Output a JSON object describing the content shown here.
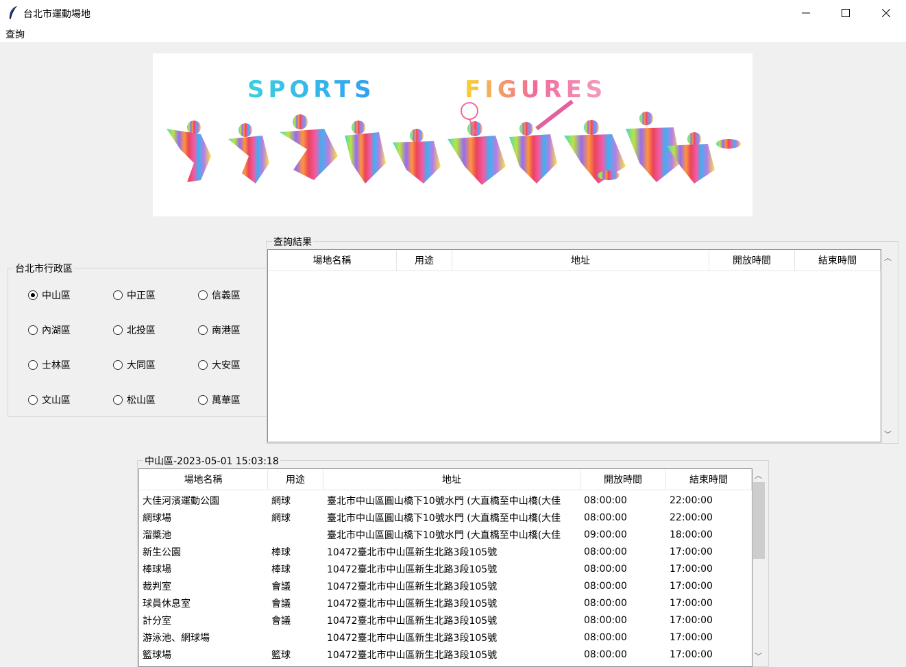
{
  "window": {
    "title": "台北市運動場地"
  },
  "menu": {
    "items": [
      "查詢"
    ]
  },
  "banner": {
    "text_left": "SPORTS",
    "text_right": "FIGURES"
  },
  "district_group": {
    "label": "台北市行政區",
    "selected": "中山區",
    "options": [
      "中山區",
      "中正區",
      "信義區",
      "內湖區",
      "北投區",
      "南港區",
      "士林區",
      "大同區",
      "大安區",
      "文山區",
      "松山區",
      "萬華區"
    ]
  },
  "query_results": {
    "label": "查詢結果",
    "columns": [
      "場地名稱",
      "用途",
      "地址",
      "開放時間",
      "結束時間"
    ],
    "rows": []
  },
  "district_table": {
    "label": "中山區-2023-05-01 15:03:18",
    "columns": [
      "場地名稱",
      "用途",
      "地址",
      "開放時間",
      "結束時間"
    ],
    "rows": [
      [
        "大佳河濱運動公園",
        "網球",
        "臺北市中山區圓山橋下10號水門 (大直橋至中山橋(大佳",
        "08:00:00",
        "22:00:00"
      ],
      [
        "網球場",
        "網球",
        "臺北市中山區圓山橋下10號水門 (大直橋至中山橋(大佳",
        "08:00:00",
        "22:00:00"
      ],
      [
        "溜槳池",
        "",
        "臺北市中山區圓山橋下10號水門 (大直橋至中山橋(大佳",
        "09:00:00",
        "18:00:00"
      ],
      [
        "新生公園",
        "棒球",
        "10472臺北市中山區新生北路3段105號",
        "08:00:00",
        "17:00:00"
      ],
      [
        "棒球場",
        "棒球",
        "10472臺北市中山區新生北路3段105號",
        "08:00:00",
        "17:00:00"
      ],
      [
        "裁判室",
        "會議",
        "10472臺北市中山區新生北路3段105號",
        "08:00:00",
        "17:00:00"
      ],
      [
        "球員休息室",
        "會議",
        "10472臺北市中山區新生北路3段105號",
        "08:00:00",
        "17:00:00"
      ],
      [
        "計分室",
        "會議",
        "10472臺北市中山區新生北路3段105號",
        "08:00:00",
        "17:00:00"
      ],
      [
        "游泳池、網球場",
        "",
        "10472臺北市中山區新生北路3段105號",
        "08:00:00",
        "17:00:00"
      ],
      [
        "籃球場",
        "籃球",
        "10472臺北市中山區新生北路3段105號",
        "08:00:00",
        "17:00:00"
      ]
    ]
  }
}
